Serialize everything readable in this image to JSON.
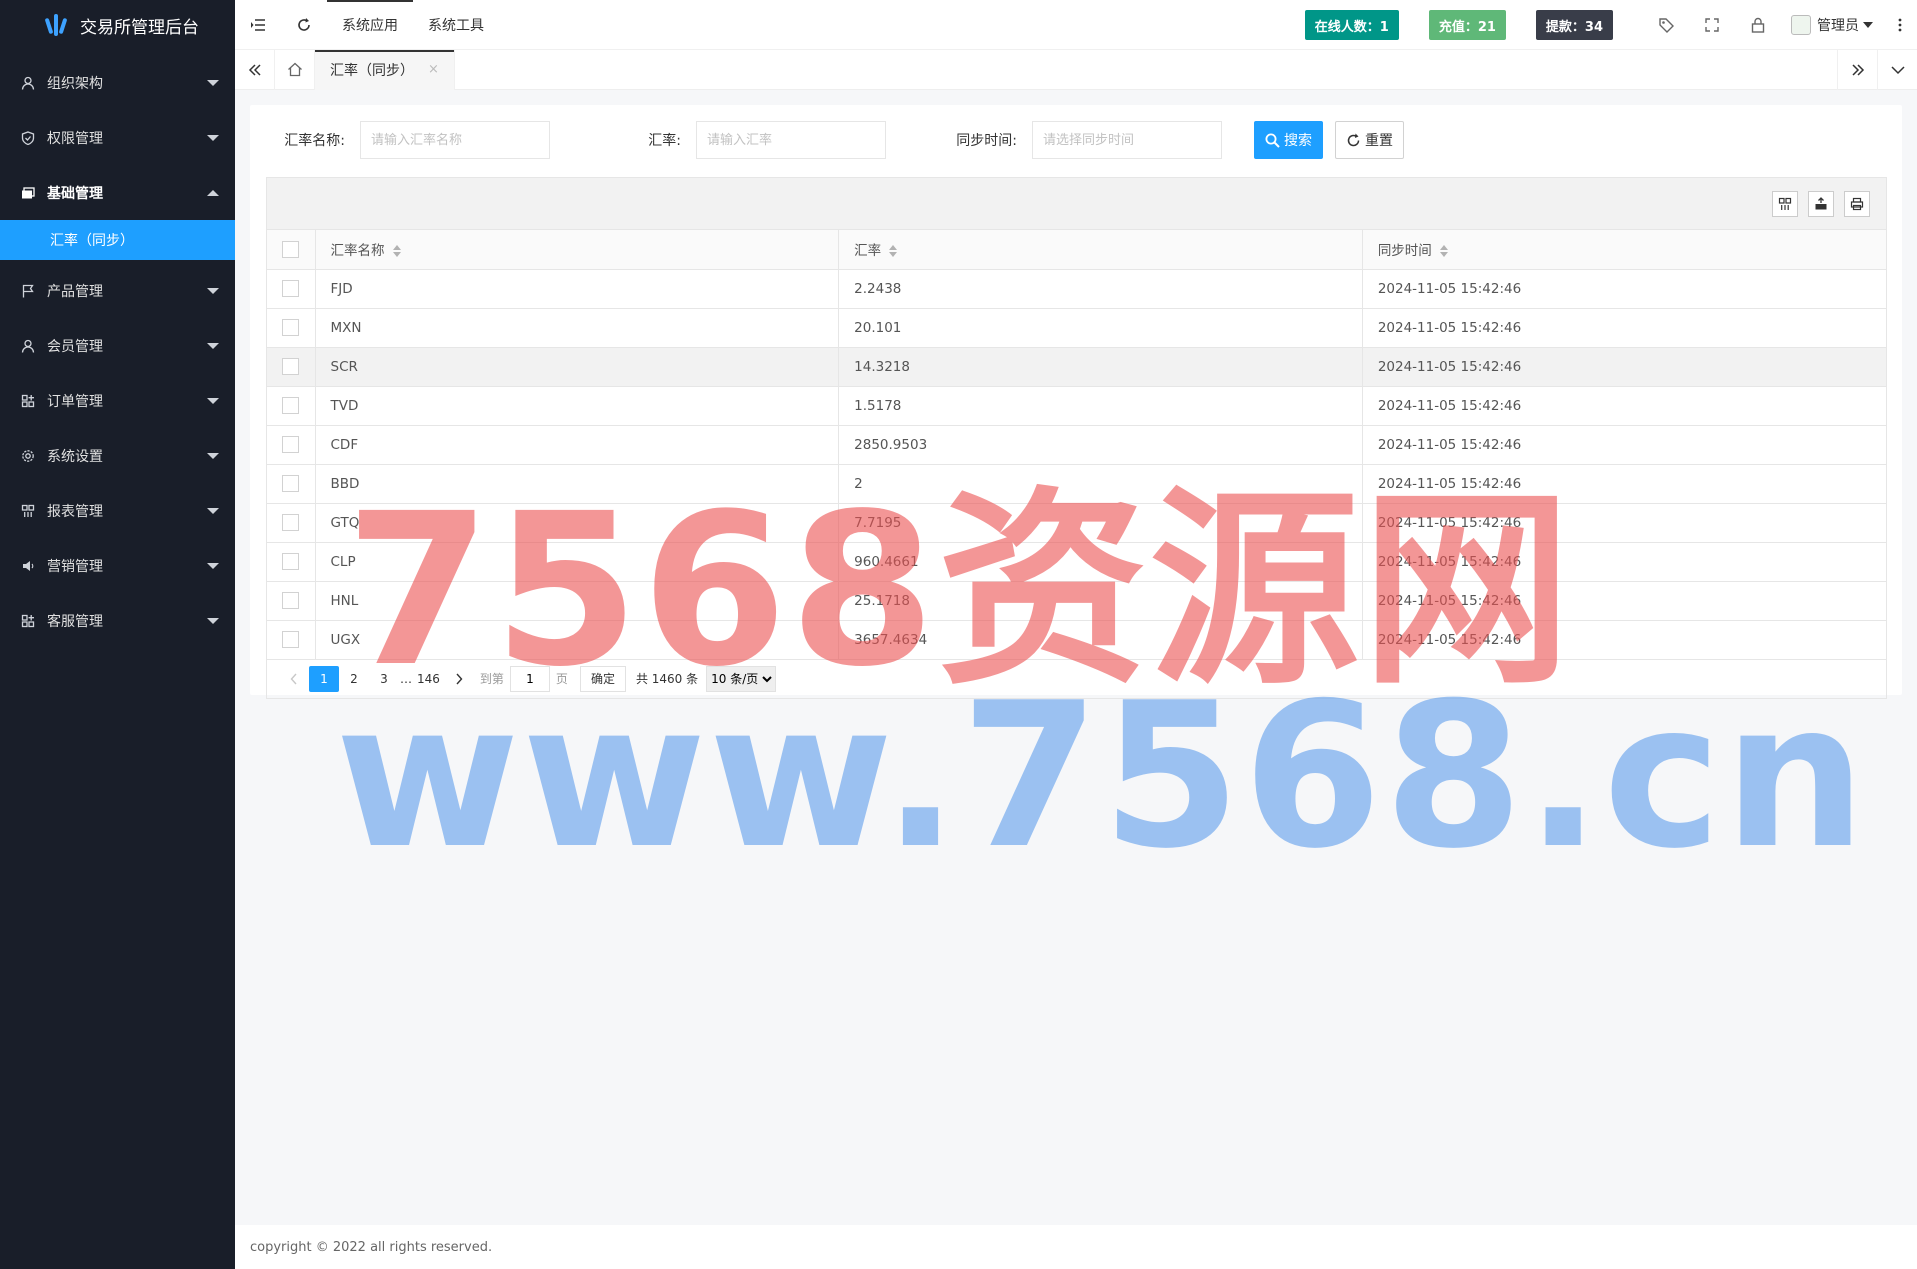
{
  "app": {
    "title": "交易所管理后台"
  },
  "sidebar": {
    "items": [
      {
        "label": "组织架构",
        "icon": "user-icon"
      },
      {
        "label": "权限管理",
        "icon": "shield-icon"
      },
      {
        "label": "基础管理",
        "icon": "card-icon",
        "open": true,
        "children": [
          {
            "label": "汇率（同步）"
          }
        ]
      },
      {
        "label": "产品管理",
        "icon": "flag-icon"
      },
      {
        "label": "会员管理",
        "icon": "user-icon"
      },
      {
        "label": "订单管理",
        "icon": "apps-icon"
      },
      {
        "label": "系统设置",
        "icon": "gear-icon"
      },
      {
        "label": "报表管理",
        "icon": "grid-icon"
      },
      {
        "label": "营销管理",
        "icon": "speaker-icon"
      },
      {
        "label": "客服管理",
        "icon": "apps-icon"
      }
    ]
  },
  "header": {
    "tabs": [
      "系统应用",
      "系统工具"
    ],
    "stats": [
      {
        "label": "在线人数：1",
        "color": "#009688"
      },
      {
        "label": "充值：21",
        "color": "#5fb878"
      },
      {
        "label": "提款：34",
        "color": "#393d49"
      }
    ],
    "user": "管理员"
  },
  "tabbar": {
    "active_tab": "汇率（同步）",
    "close": "×"
  },
  "search": {
    "name_label": "汇率名称:",
    "name_placeholder": "请输入汇率名称",
    "rate_label": "汇率:",
    "rate_placeholder": "请输入汇率",
    "time_label": "同步时间:",
    "time_placeholder": "请选择同步时间",
    "search_btn": "搜索",
    "reset_btn": "重置"
  },
  "table": {
    "columns": [
      "汇率名称",
      "汇率",
      "同步时间"
    ],
    "rows": [
      [
        "FJD",
        "2.2438",
        "2024-11-05 15:42:46"
      ],
      [
        "MXN",
        "20.101",
        "2024-11-05 15:42:46"
      ],
      [
        "SCR",
        "14.3218",
        "2024-11-05 15:42:46"
      ],
      [
        "TVD",
        "1.5178",
        "2024-11-05 15:42:46"
      ],
      [
        "CDF",
        "2850.9503",
        "2024-11-05 15:42:46"
      ],
      [
        "BBD",
        "2",
        "2024-11-05 15:42:46"
      ],
      [
        "GTQ",
        "7.7195",
        "2024-11-05 15:42:46"
      ],
      [
        "CLP",
        "960.4661",
        "2024-11-05 15:42:46"
      ],
      [
        "HNL",
        "25.1718",
        "2024-11-05 15:42:46"
      ],
      [
        "UGX",
        "3657.4634",
        "2024-11-05 15:42:46"
      ]
    ],
    "highlight_row": 2
  },
  "pager": {
    "pages": [
      "1",
      "2",
      "3"
    ],
    "ellipsis": "…",
    "last": "146",
    "goto_label": "到第",
    "goto_value": "1",
    "page_label": "页",
    "confirm": "确定",
    "total": "共 1460 条",
    "per_page": "10 条/页"
  },
  "footer": {
    "text": "copyright © 2022 all rights reserved."
  },
  "watermark": {
    "line1": "7568资源网",
    "line2": "www.7568.cn"
  }
}
